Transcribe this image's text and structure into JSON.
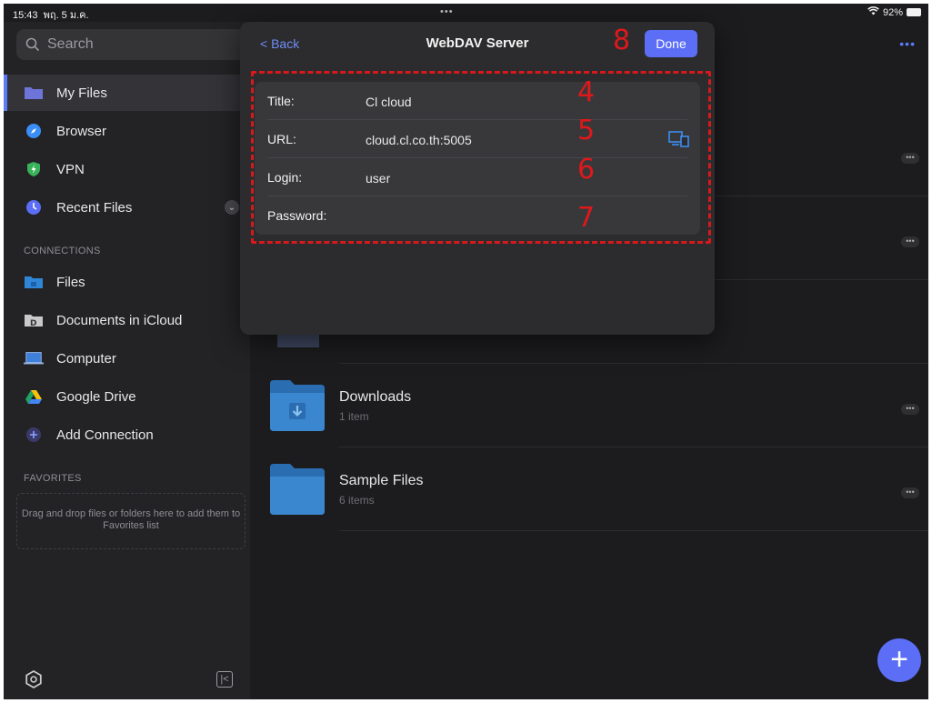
{
  "status_bar": {
    "time": "15:43",
    "date": "พฤ. 5 ม.ค.",
    "center_dots": "•••",
    "battery": "92%"
  },
  "sidebar": {
    "search_placeholder": "Search",
    "items": [
      {
        "label": "My Files",
        "icon": "folder-icon",
        "active": true
      },
      {
        "label": "Browser",
        "icon": "compass-icon"
      },
      {
        "label": "VPN",
        "icon": "shield-icon"
      },
      {
        "label": "Recent Files",
        "icon": "clock-icon"
      }
    ],
    "connections_header": "CONNECTIONS",
    "connections": [
      {
        "label": "Files",
        "icon": "files-folder-icon"
      },
      {
        "label": "Documents in iCloud",
        "icon": "documents-icon"
      },
      {
        "label": "Computer",
        "icon": "laptop-icon"
      },
      {
        "label": "Google Drive",
        "icon": "google-drive-icon"
      },
      {
        "label": "Add Connection",
        "icon": "plus-circle-icon"
      }
    ],
    "favorites_header": "FAVORITES",
    "favorites_hint": "Drag and drop files or folders here to add them to Favorites list"
  },
  "main": {
    "more_label": "•••",
    "rows": [
      {
        "name": "Downloads",
        "sub": "1 item"
      },
      {
        "name": "Sample Files",
        "sub": "6 items"
      }
    ],
    "fab_label": "+"
  },
  "dialog": {
    "back_label": "Back",
    "title": "WebDAV Server",
    "done_label": "Done",
    "fields": [
      {
        "label": "Title:",
        "value": "Cl cloud"
      },
      {
        "label": "URL:",
        "value": "cloud.cl.co.th:5005"
      },
      {
        "label": "Login:",
        "value": "user"
      },
      {
        "label": "Password:",
        "value": ""
      }
    ]
  },
  "annotations": {
    "n4": "4",
    "n5": "5",
    "n6": "6",
    "n7": "7",
    "n8": "8"
  },
  "colors": {
    "accent": "#5b6ef5",
    "annotation_red": "#d9181b",
    "background": "#1c1c1e"
  }
}
